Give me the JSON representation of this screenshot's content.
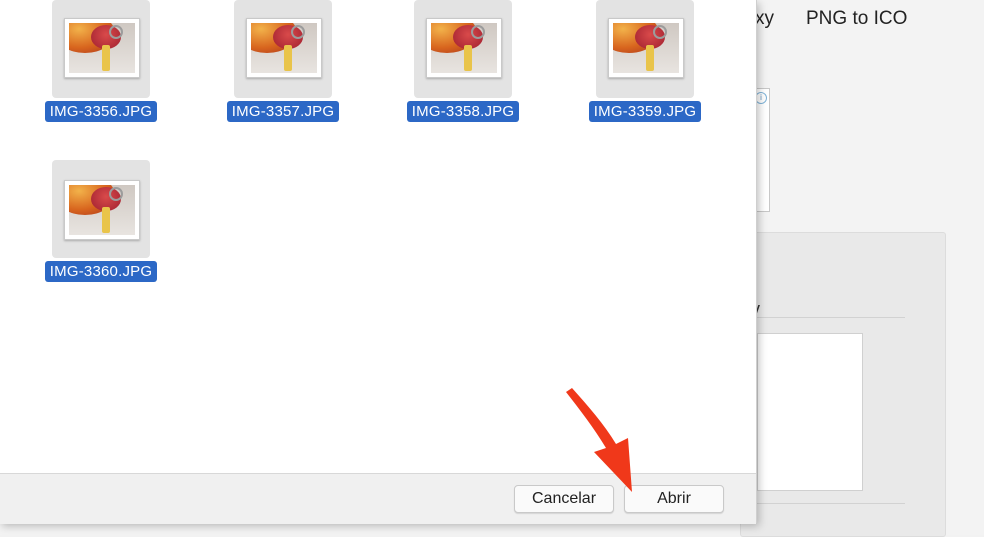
{
  "background_page": {
    "nav_partial": "xy",
    "nav_item": "PNG to ICO",
    "panel_fragment": "v",
    "ad_corner_icon": "i"
  },
  "dialog": {
    "files": [
      {
        "name": "IMG-3356.JPG"
      },
      {
        "name": "IMG-3357.JPG"
      },
      {
        "name": "IMG-3358.JPG"
      },
      {
        "name": "IMG-3359.JPG"
      },
      {
        "name": "IMG-3360.JPG"
      }
    ],
    "buttons": {
      "cancel": "Cancelar",
      "open": "Abrir"
    }
  },
  "colors": {
    "selection": "#2c68c6",
    "arrow": "#f0381a"
  },
  "icons": {
    "annotation": "red-arrow-icon"
  }
}
